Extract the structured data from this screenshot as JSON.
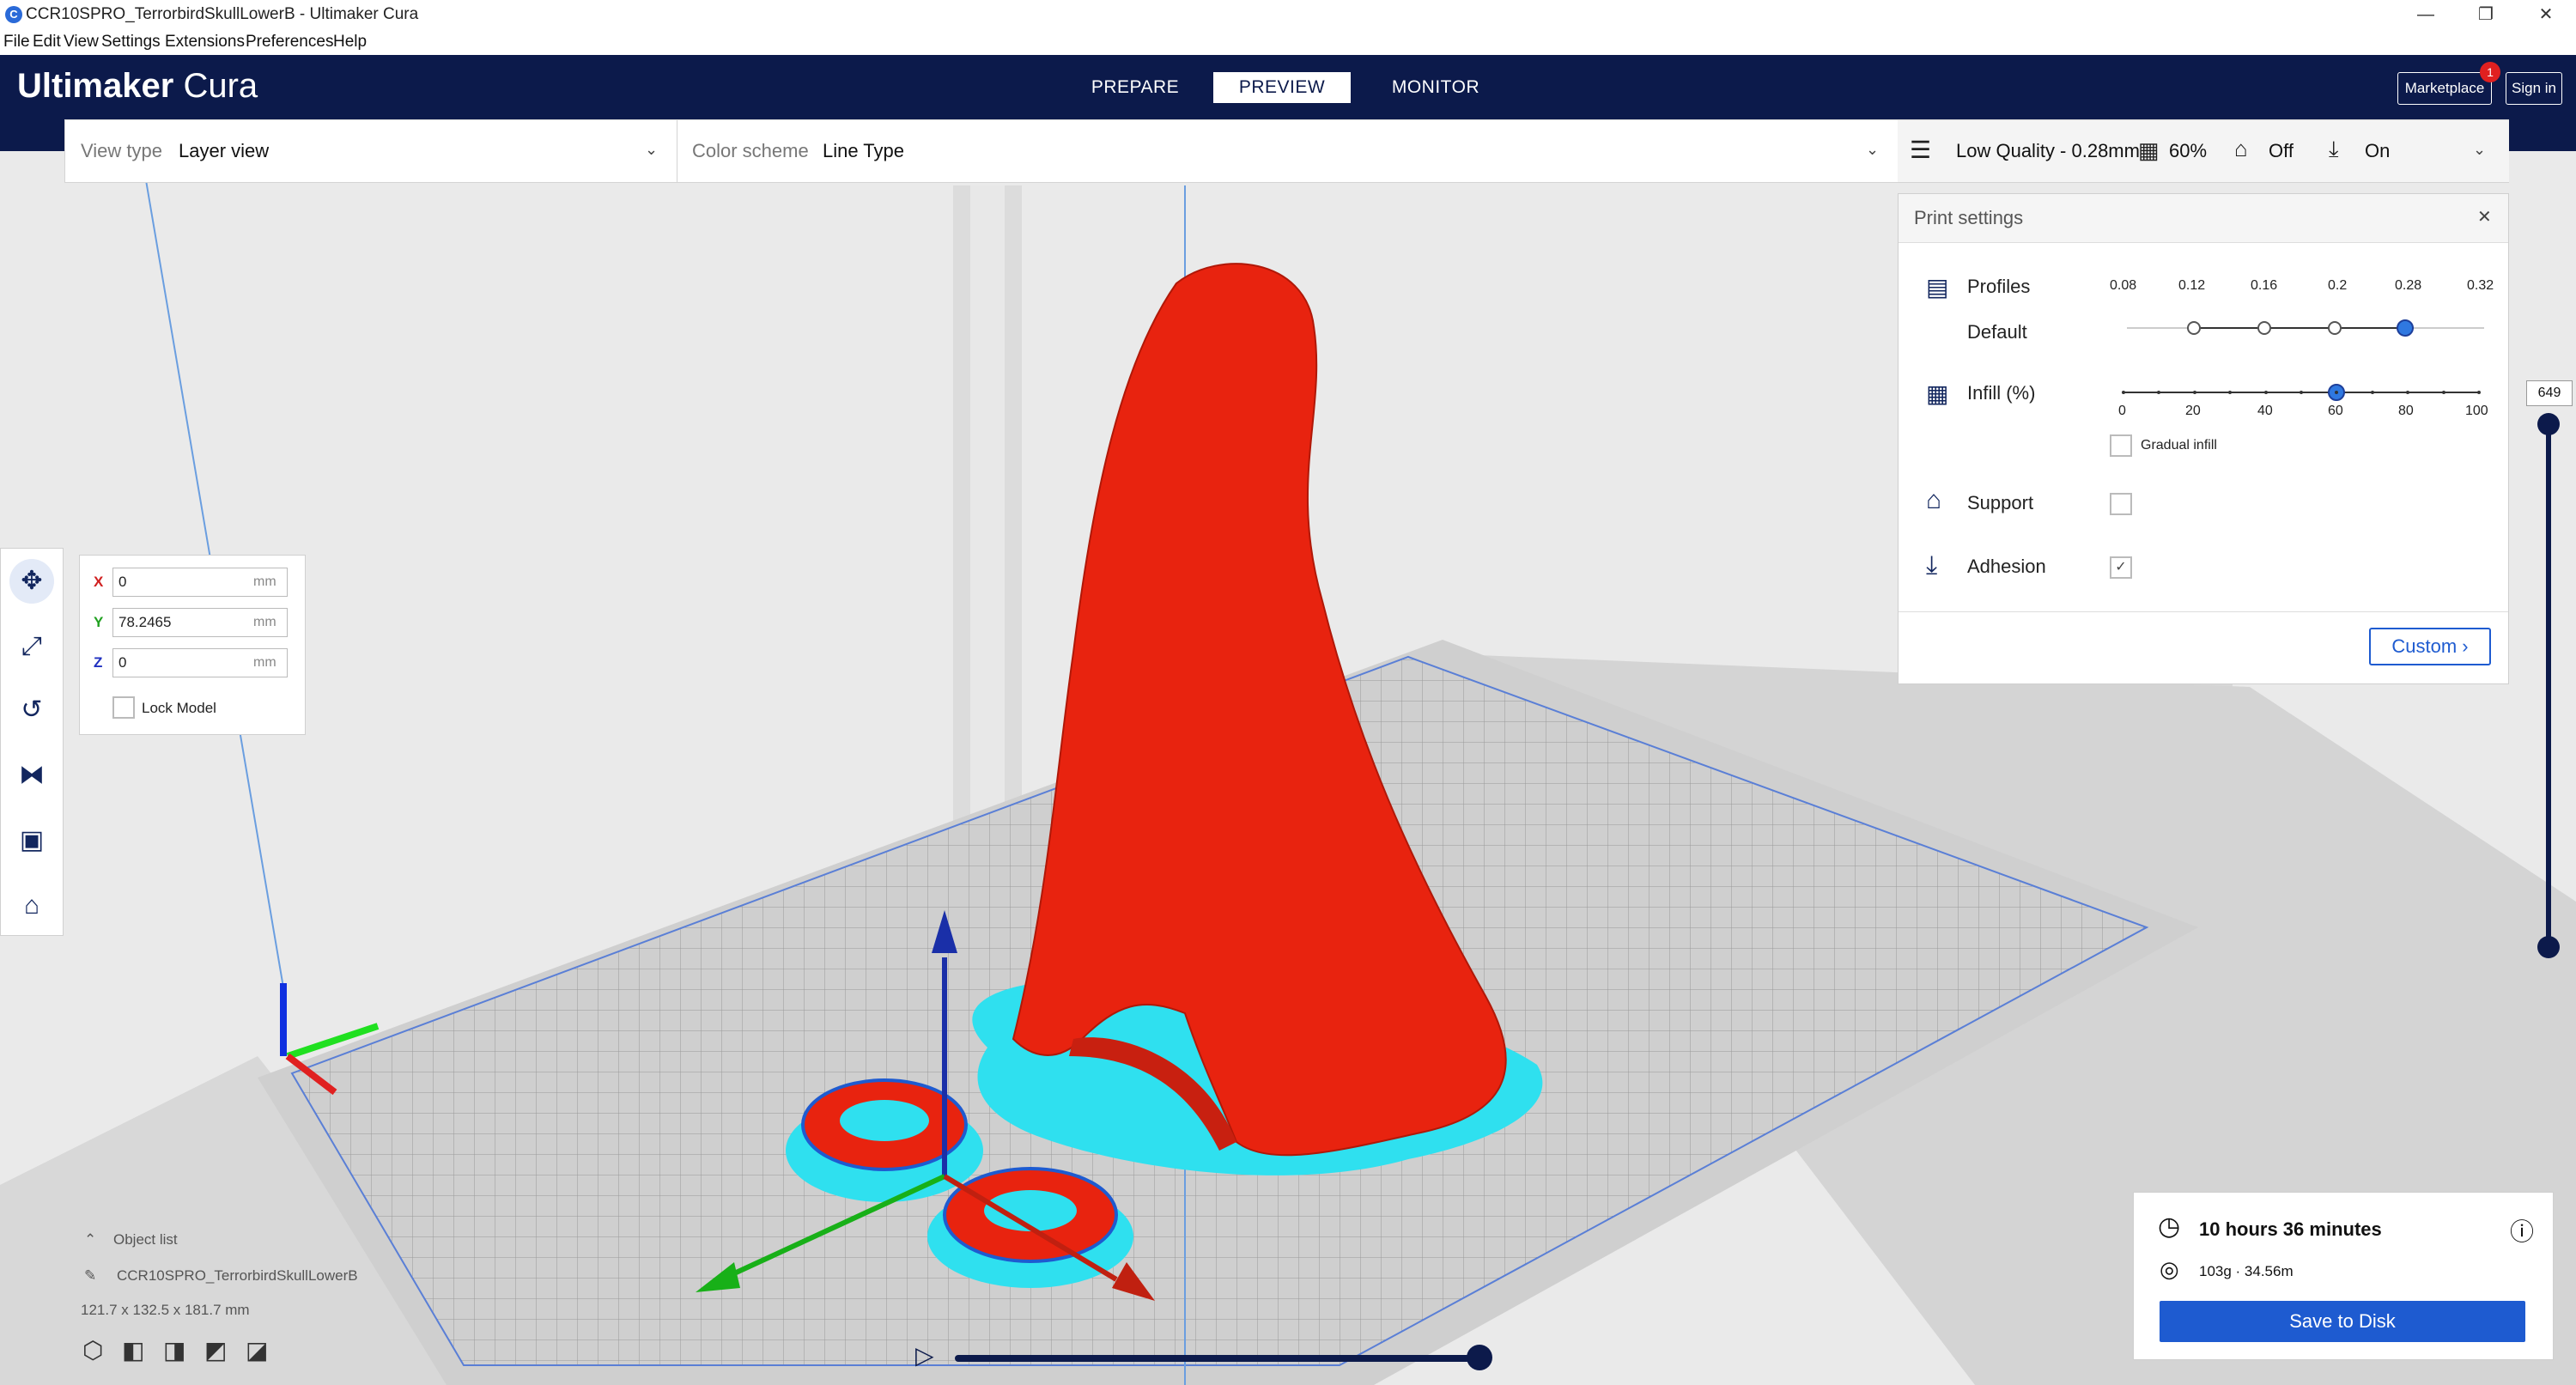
{
  "window": {
    "title": "CCR10SPRO_TerrorbirdSkullLowerB - Ultimaker Cura",
    "minimize": "—",
    "maximize": "❐",
    "close": "✕"
  },
  "menu": [
    "File",
    "Edit",
    "View",
    "Settings",
    "Extensions",
    "Preferences",
    "Help"
  ],
  "header": {
    "brand_bold": "Ultimaker",
    "brand_light": "Cura",
    "stages": [
      "PREPARE",
      "PREVIEW",
      "MONITOR"
    ],
    "active_stage": "PREVIEW",
    "marketplace_label": "Marketplace",
    "marketplace_badge": "1",
    "signin_label": "Sign in"
  },
  "viewbar": {
    "view_type_label": "View type",
    "view_type_value": "Layer view",
    "color_scheme_label": "Color scheme",
    "color_scheme_value": "Line Type",
    "quality": "Low Quality - 0.28mm",
    "infill": "60%",
    "support": "Off",
    "adhesion": "On"
  },
  "print_settings": {
    "title": "Print settings",
    "close": "✕",
    "profiles_label": "Profiles",
    "profiles_sub": "Default",
    "profile_ticks": [
      "0.08",
      "0.12",
      "0.16",
      "0.2",
      "0.28",
      "0.32"
    ],
    "profile_selected": "0.28",
    "infill_label": "Infill (%)",
    "infill_ticks": [
      "0",
      "20",
      "40",
      "60",
      "80",
      "100"
    ],
    "infill_value": 60,
    "gradual_infill_label": "Gradual infill",
    "support_label": "Support",
    "support_checked": false,
    "adhesion_label": "Adhesion",
    "adhesion_checked": true,
    "custom_label": "Custom"
  },
  "transform": {
    "x_label": "X",
    "x_value": "0",
    "y_label": "Y",
    "y_value": "78.2465",
    "z_label": "Z",
    "z_value": "0",
    "unit": "mm",
    "lock_label": "Lock Model"
  },
  "layer_slider": {
    "current_layer": "649"
  },
  "object_list": {
    "label": "Object list",
    "name": "CCR10SPRO_TerrorbirdSkullLowerB",
    "dimensions": "121.7 x 132.5 x 181.7 mm"
  },
  "job": {
    "time": "10 hours 36 minutes",
    "material": "103g · 34.56m",
    "save_label": "Save to Disk"
  },
  "colors": {
    "header": "#0c1a4b",
    "accent": "#1e5bd0",
    "model": "#e8230f",
    "skirt": "#2fe0ef"
  }
}
